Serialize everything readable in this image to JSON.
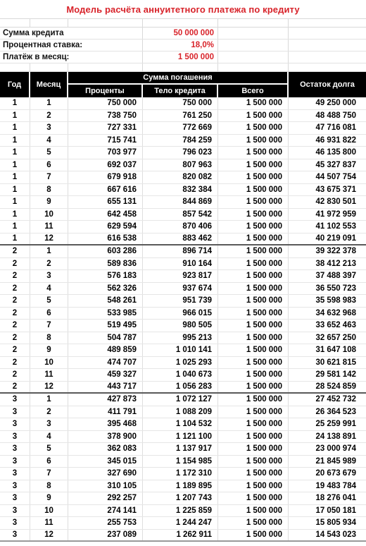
{
  "title": "Модель расчёта аннуитетного платежа по кредиту",
  "parameters": [
    {
      "label": "Сумма кредита",
      "value": "50 000 000"
    },
    {
      "label": "Процентная ставка:",
      "value": "18,0%"
    },
    {
      "label": "Платёж в месяц:",
      "value": "1 500 000"
    }
  ],
  "colors": {
    "title": "#d8232a",
    "value": "#d8232a",
    "header_bg": "#000000",
    "header_fg": "#ffffff"
  },
  "table": {
    "headers": {
      "year": "Год",
      "month": "Месяц",
      "group": "Сумма погашения",
      "interest": "Проценты",
      "principal": "Тело кредита",
      "total": "Всего",
      "balance": "Остаток долга"
    },
    "rows": [
      {
        "year": "1",
        "month": "1",
        "interest": "750 000",
        "principal": "750 000",
        "total": "1 500 000",
        "balance": "49 250 000",
        "emph": false,
        "year_end": false
      },
      {
        "year": "1",
        "month": "2",
        "interest": "738 750",
        "principal": "761 250",
        "total": "1 500 000",
        "balance": "48 488 750",
        "emph": false,
        "year_end": false
      },
      {
        "year": "1",
        "month": "3",
        "interest": "727 331",
        "principal": "772 669",
        "total": "1 500 000",
        "balance": "47 716 081",
        "emph": false,
        "year_end": false
      },
      {
        "year": "1",
        "month": "4",
        "interest": "715 741",
        "principal": "784 259",
        "total": "1 500 000",
        "balance": "46 931 822",
        "emph": false,
        "year_end": false
      },
      {
        "year": "1",
        "month": "5",
        "interest": "703 977",
        "principal": "796 023",
        "total": "1 500 000",
        "balance": "46 135 800",
        "emph": false,
        "year_end": false
      },
      {
        "year": "1",
        "month": "6",
        "interest": "692 037",
        "principal": "807 963",
        "total": "1 500 000",
        "balance": "45 327 837",
        "emph": false,
        "year_end": false
      },
      {
        "year": "1",
        "month": "7",
        "interest": "679 918",
        "principal": "820 082",
        "total": "1 500 000",
        "balance": "44 507 754",
        "emph": false,
        "year_end": false
      },
      {
        "year": "1",
        "month": "8",
        "interest": "667 616",
        "principal": "832 384",
        "total": "1 500 000",
        "balance": "43 675 371",
        "emph": false,
        "year_end": false
      },
      {
        "year": "1",
        "month": "9",
        "interest": "655 131",
        "principal": "844 869",
        "total": "1 500 000",
        "balance": "42 830 501",
        "emph": false,
        "year_end": false
      },
      {
        "year": "1",
        "month": "10",
        "interest": "642 458",
        "principal": "857 542",
        "total": "1 500 000",
        "balance": "41 972 959",
        "emph": false,
        "year_end": false
      },
      {
        "year": "1",
        "month": "11",
        "interest": "629 594",
        "principal": "870 406",
        "total": "1 500 000",
        "balance": "41 102 553",
        "emph": false,
        "year_end": false
      },
      {
        "year": "1",
        "month": "12",
        "interest": "616 538",
        "principal": "883 462",
        "total": "1 500 000",
        "balance": "40 219 091",
        "emph": true,
        "year_end": true
      },
      {
        "year": "2",
        "month": "1",
        "interest": "603 286",
        "principal": "896 714",
        "total": "1 500 000",
        "balance": "39 322 378",
        "emph": false,
        "year_end": false
      },
      {
        "year": "2",
        "month": "2",
        "interest": "589 836",
        "principal": "910 164",
        "total": "1 500 000",
        "balance": "38 412 213",
        "emph": false,
        "year_end": false
      },
      {
        "year": "2",
        "month": "3",
        "interest": "576 183",
        "principal": "923 817",
        "total": "1 500 000",
        "balance": "37 488 397",
        "emph": false,
        "year_end": false
      },
      {
        "year": "2",
        "month": "4",
        "interest": "562 326",
        "principal": "937 674",
        "total": "1 500 000",
        "balance": "36 550 723",
        "emph": false,
        "year_end": false
      },
      {
        "year": "2",
        "month": "5",
        "interest": "548 261",
        "principal": "951 739",
        "total": "1 500 000",
        "balance": "35 598 983",
        "emph": false,
        "year_end": false
      },
      {
        "year": "2",
        "month": "6",
        "interest": "533 985",
        "principal": "966 015",
        "total": "1 500 000",
        "balance": "34 632 968",
        "emph": false,
        "year_end": false
      },
      {
        "year": "2",
        "month": "7",
        "interest": "519 495",
        "principal": "980 505",
        "total": "1 500 000",
        "balance": "33 652 463",
        "emph": false,
        "year_end": false
      },
      {
        "year": "2",
        "month": "8",
        "interest": "504 787",
        "principal": "995 213",
        "total": "1 500 000",
        "balance": "32 657 250",
        "emph": false,
        "year_end": false
      },
      {
        "year": "2",
        "month": "9",
        "interest": "489 859",
        "principal": "1 010 141",
        "total": "1 500 000",
        "balance": "31 647 108",
        "emph": false,
        "year_end": false
      },
      {
        "year": "2",
        "month": "10",
        "interest": "474 707",
        "principal": "1 025 293",
        "total": "1 500 000",
        "balance": "30 621 815",
        "emph": false,
        "year_end": false
      },
      {
        "year": "2",
        "month": "11",
        "interest": "459 327",
        "principal": "1 040 673",
        "total": "1 500 000",
        "balance": "29 581 142",
        "emph": false,
        "year_end": false
      },
      {
        "year": "2",
        "month": "12",
        "interest": "443 717",
        "principal": "1 056 283",
        "total": "1 500 000",
        "balance": "28 524 859",
        "emph": true,
        "year_end": true
      },
      {
        "year": "3",
        "month": "1",
        "interest": "427 873",
        "principal": "1 072 127",
        "total": "1 500 000",
        "balance": "27 452 732",
        "emph": false,
        "year_end": false
      },
      {
        "year": "3",
        "month": "2",
        "interest": "411 791",
        "principal": "1 088 209",
        "total": "1 500 000",
        "balance": "26 364 523",
        "emph": false,
        "year_end": false
      },
      {
        "year": "3",
        "month": "3",
        "interest": "395 468",
        "principal": "1 104 532",
        "total": "1 500 000",
        "balance": "25 259 991",
        "emph": false,
        "year_end": false
      },
      {
        "year": "3",
        "month": "4",
        "interest": "378 900",
        "principal": "1 121 100",
        "total": "1 500 000",
        "balance": "24 138 891",
        "emph": false,
        "year_end": false
      },
      {
        "year": "3",
        "month": "5",
        "interest": "362 083",
        "principal": "1 137 917",
        "total": "1 500 000",
        "balance": "23 000 974",
        "emph": false,
        "year_end": false
      },
      {
        "year": "3",
        "month": "6",
        "interest": "345 015",
        "principal": "1 154 985",
        "total": "1 500 000",
        "balance": "21 845 989",
        "emph": false,
        "year_end": false
      },
      {
        "year": "3",
        "month": "7",
        "interest": "327 690",
        "principal": "1 172 310",
        "total": "1 500 000",
        "balance": "20 673 679",
        "emph": false,
        "year_end": false
      },
      {
        "year": "3",
        "month": "8",
        "interest": "310 105",
        "principal": "1 189 895",
        "total": "1 500 000",
        "balance": "19 483 784",
        "emph": false,
        "year_end": false
      },
      {
        "year": "3",
        "month": "9",
        "interest": "292 257",
        "principal": "1 207 743",
        "total": "1 500 000",
        "balance": "18 276 041",
        "emph": false,
        "year_end": false
      },
      {
        "year": "3",
        "month": "10",
        "interest": "274 141",
        "principal": "1 225 859",
        "total": "1 500 000",
        "balance": "17 050 181",
        "emph": false,
        "year_end": false
      },
      {
        "year": "3",
        "month": "11",
        "interest": "255 753",
        "principal": "1 244 247",
        "total": "1 500 000",
        "balance": "15 805 934",
        "emph": false,
        "year_end": false
      },
      {
        "year": "3",
        "month": "12",
        "interest": "237 089",
        "principal": "1 262 911",
        "total": "1 500 000",
        "balance": "14 543 023",
        "emph": true,
        "year_end": false
      }
    ]
  }
}
